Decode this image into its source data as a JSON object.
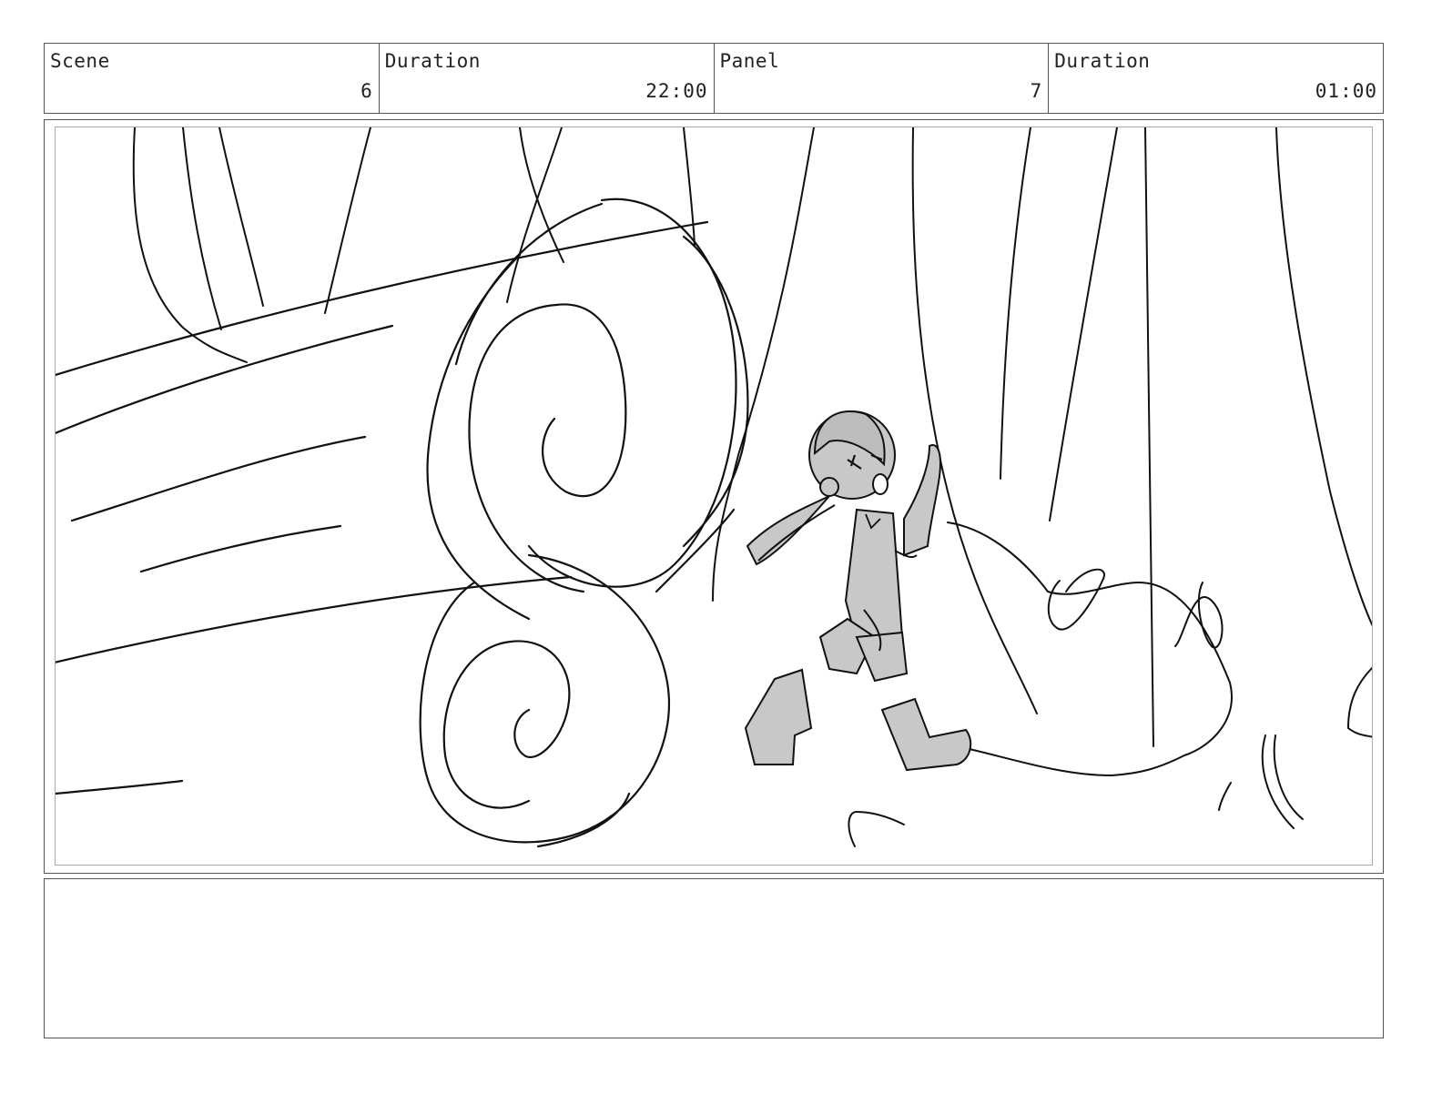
{
  "header": {
    "scene_label": "Scene",
    "scene_value": "6",
    "scene_duration_label": "Duration",
    "scene_duration_value": "22:00",
    "panel_label": "Panel",
    "panel_value": "7",
    "panel_duration_label": "Duration",
    "panel_duration_value": "01:00"
  },
  "notes": {
    "text": ""
  }
}
